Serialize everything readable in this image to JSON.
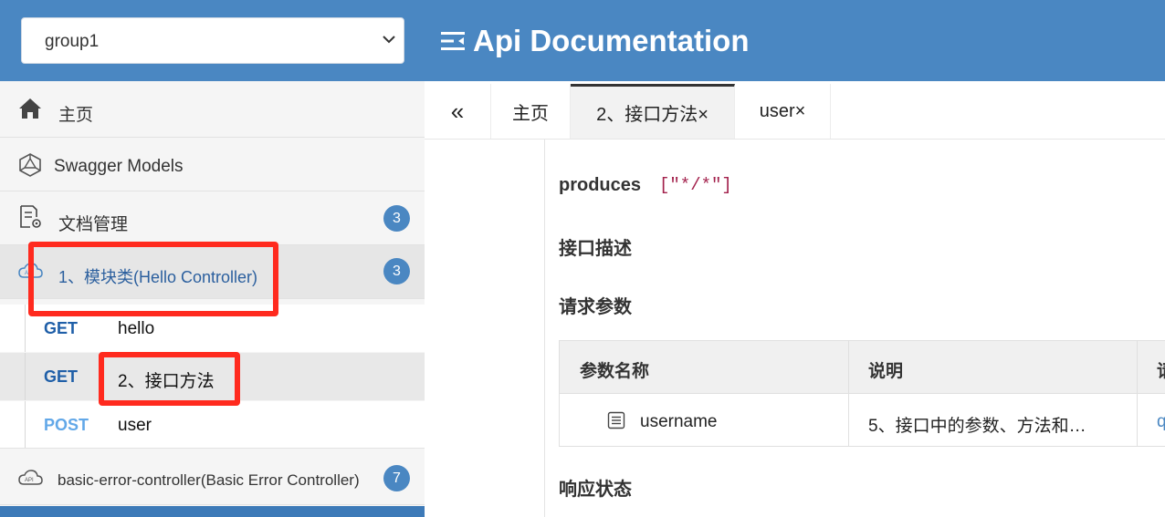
{
  "header": {
    "group_select": "group1",
    "title": "Api Documentation"
  },
  "sidebar": {
    "home": "主页",
    "swagger_models": "Swagger Models",
    "doc_manage": "文档管理",
    "doc_manage_count": "3",
    "hello_controller": "1、模块类(Hello Controller)",
    "hello_controller_count": "3",
    "apis": [
      {
        "method": "GET",
        "path": "hello"
      },
      {
        "method": "GET",
        "path": "2、接口方法"
      },
      {
        "method": "POST",
        "path": "user"
      }
    ],
    "basic_error": "basic-error-controller(Basic Error Controller)",
    "basic_error_count": "7"
  },
  "tabs": {
    "collapse": "«",
    "items": [
      "主页",
      "2、接口方法×",
      "user×"
    ]
  },
  "content": {
    "produces_label": "produces",
    "produces_value": "[\"*/*\"]",
    "desc_label": "接口描述",
    "params_label": "请求参数",
    "table": {
      "headers": [
        "参数名称",
        "说明",
        "请"
      ],
      "row": {
        "name": "username",
        "desc": "5、接口中的参数、方法和…",
        "extra": "q"
      }
    },
    "response_label": "响应状态"
  },
  "colors": {
    "header_bg": "#4a87c2",
    "get_method": "#1f5fa8",
    "post_method": "#62a8e8",
    "highlight": "#ff2a1e",
    "badge": "#4a87c2"
  }
}
